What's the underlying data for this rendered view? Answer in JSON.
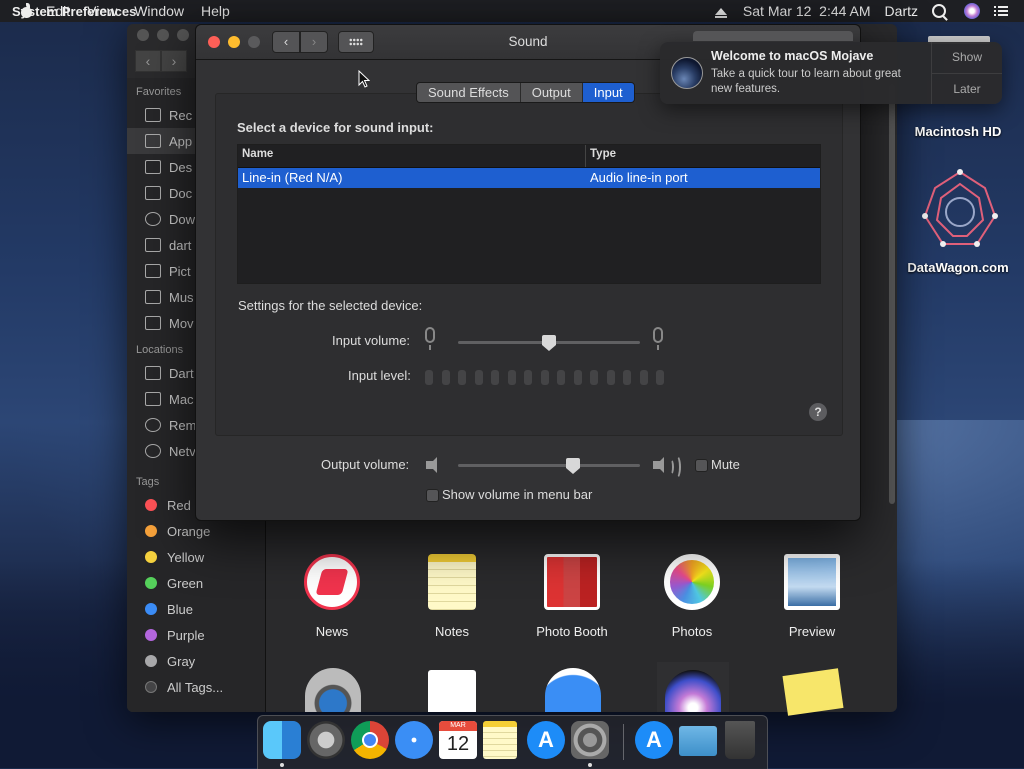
{
  "menubar": {
    "app_name": "System Preferences",
    "menus": [
      "Edit",
      "View",
      "Window",
      "Help"
    ],
    "datetime": "Sat Mar 12  2:44 AM",
    "user": "Dartz"
  },
  "finder": {
    "favorites_header": "Favorites",
    "favorites": [
      "Rec",
      "App",
      "Des",
      "Doc",
      "Dow",
      "dart",
      "Pict",
      "Mus",
      "Mov"
    ],
    "locations_header": "Locations",
    "locations": [
      "Dart",
      "Mac",
      "Rem",
      "Netv"
    ],
    "tags_header": "Tags",
    "tags": [
      {
        "label": "Red",
        "color": "#ff5257"
      },
      {
        "label": "Orange",
        "color": "#f7a23b"
      },
      {
        "label": "Yellow",
        "color": "#f6d23f"
      },
      {
        "label": "Green",
        "color": "#55d05b"
      },
      {
        "label": "Blue",
        "color": "#3b8cf6"
      },
      {
        "label": "Purple",
        "color": "#b366de"
      },
      {
        "label": "Gray",
        "color": "#a8a8aa"
      },
      {
        "label": "All Tags...",
        "color": "#444446"
      }
    ],
    "apps": [
      "News",
      "Notes",
      "Photo Booth",
      "Photos",
      "Preview"
    ]
  },
  "sound": {
    "title": "Sound",
    "tabs": [
      "Sound Effects",
      "Output",
      "Input"
    ],
    "active_tab": "Input",
    "select_label": "Select a device for sound input:",
    "columns": [
      "Name",
      "Type"
    ],
    "rows": [
      {
        "name": "Line-in (Red N/A)",
        "type": "Audio line-in port"
      }
    ],
    "settings_label": "Settings for the selected device:",
    "input_volume_label": "Input volume:",
    "input_volume": 0.5,
    "input_level_label": "Input level:",
    "help": "?",
    "output_volume_label": "Output volume:",
    "output_volume": 0.63,
    "mute_label": "Mute",
    "show_volume_label": "Show volume in menu bar"
  },
  "notification": {
    "title": "Welcome to macOS Mojave",
    "body": "Take a quick tour to learn about great new features.",
    "show": "Show",
    "later": "Later"
  },
  "desktop": {
    "icons": [
      "Macintosh HD",
      "DataWagon.com"
    ]
  },
  "dock": {
    "apps": [
      "Finder",
      "Launchpad",
      "Chrome",
      "Safari",
      "Calendar",
      "Notes",
      "App Store",
      "System Preferences",
      "App Store Downloads",
      "Downloads",
      "Trash"
    ],
    "calendar_month": "MAR",
    "calendar_day": "12"
  }
}
